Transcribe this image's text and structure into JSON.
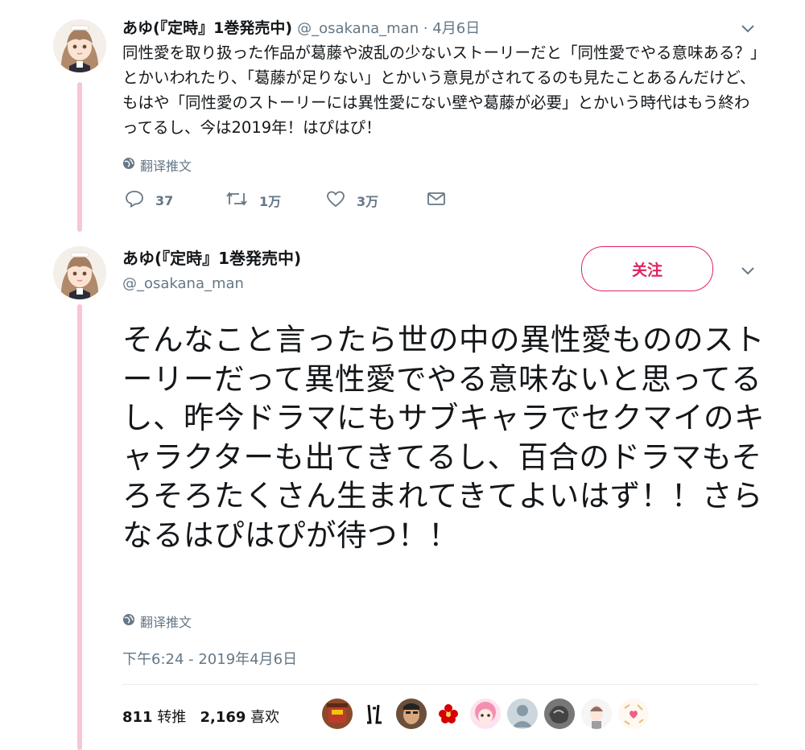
{
  "tweet1": {
    "name": "あゆ(『定時』1巻発売中)",
    "handle": "@_osakana_man",
    "separator": " · ",
    "date": "4月6日",
    "text": "同性愛を取り扱った作品が葛藤や波乱の少ないストーリーだと「同性愛でやる意味ある？」とかいわれたり、「葛藤が足りない」とかいう意見がされてるのも見たことあるんだけど、もはや「同性愛のストーリーには異性愛にない壁や葛藤が必要」とかいう時代はもう終わってるし、今は2019年！はぴはぴ！",
    "translate_label": "翻译推文",
    "replies": "37",
    "retweets": "1万",
    "likes": "3万"
  },
  "tweet2": {
    "name": "あゆ(『定時』1巻発売中)",
    "handle": "@_osakana_man",
    "follow_label": "关注",
    "text": "そんなこと言ったら世の中の異性愛もののストーリーだって異性愛でやる意味ないと思ってるし、昨今ドラマにもサブキャラでセクマイのキャラクターも出てきてるし、百合のドラマもそろそろたくさん生まれてきてよいはず！！さらなるはぴはぴが待つ！！",
    "translate_label": "翻译推文",
    "timestamp": "下午6:24 - 2019年4月6日",
    "retweet_count": "811",
    "retweet_label": "转推",
    "like_count": "2,169",
    "like_label": "喜欢"
  },
  "colors": {
    "accent": "#e0245e",
    "thread_line": "#f9c6d3",
    "secondary_text": "#657786"
  },
  "icons": [
    "reply-icon",
    "retweet-icon",
    "like-icon",
    "message-icon",
    "globe-icon",
    "chevron-down-icon"
  ]
}
